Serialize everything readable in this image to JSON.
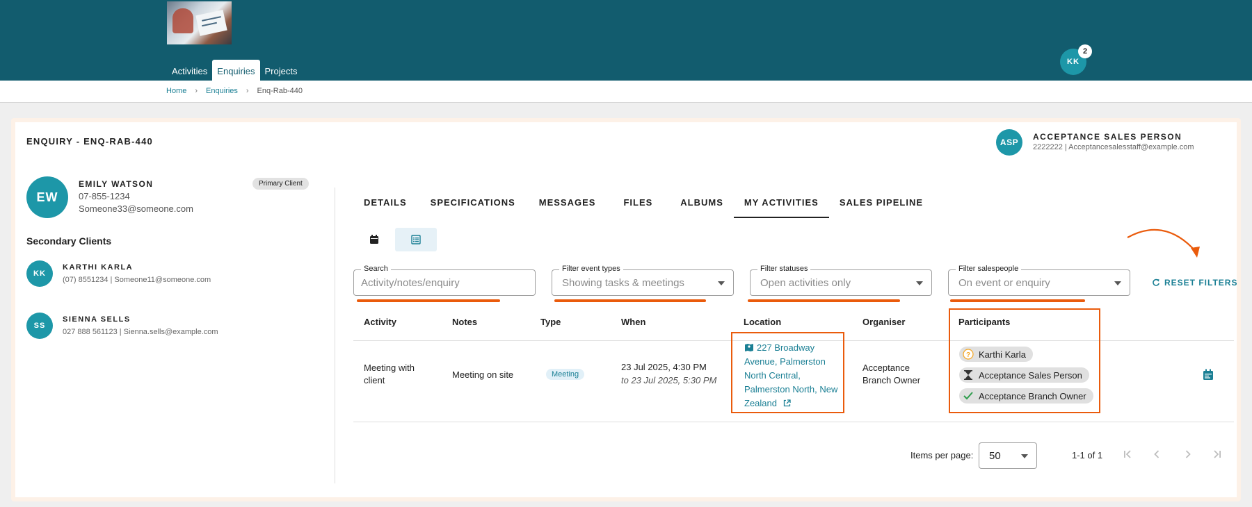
{
  "nav": {
    "items": [
      {
        "label": "Activities"
      },
      {
        "label": "Enquiries",
        "active": true
      },
      {
        "label": "Projects"
      }
    ]
  },
  "user": {
    "initials": "KK",
    "notifications": "2"
  },
  "breadcrumb": {
    "home": "Home",
    "enquiries": "Enquiries",
    "current": "Enq-Rab-440"
  },
  "enquiry": {
    "title": "ENQUIRY - ENQ-RAB-440"
  },
  "salesperson": {
    "initials": "ASP",
    "name": "ACCEPTANCE SALES PERSON",
    "info": "2222222  |  Acceptancesalesstaff@example.com"
  },
  "primary_client": {
    "initials": "EW",
    "name": "EMILY WATSON",
    "phone": "07-855-1234",
    "email": "Someone33@someone.com",
    "badge": "Primary Client"
  },
  "secondary": {
    "title": "Secondary Clients",
    "clients": [
      {
        "initials": "KK",
        "name": "KARTHI KARLA",
        "info": "(07) 8551234  |  Someone11@someone.com"
      },
      {
        "initials": "SS",
        "name": "SIENNA SELLS",
        "info": "027 888 561123  |  Sienna.sells@example.com"
      }
    ]
  },
  "tabs": [
    {
      "label": "DETAILS"
    },
    {
      "label": "SPECIFICATIONS"
    },
    {
      "label": "MESSAGES"
    },
    {
      "label": "FILES"
    },
    {
      "label": "ALBUMS"
    },
    {
      "label": "MY ACTIVITIES",
      "active": true
    },
    {
      "label": "SALES PIPELINE"
    }
  ],
  "filters": {
    "search": {
      "label": "Search",
      "placeholder": "Activity/notes/enquiry",
      "value": ""
    },
    "event_types": {
      "label": "Filter event types",
      "value": "Showing tasks & meetings"
    },
    "statuses": {
      "label": "Filter statuses",
      "value": "Open activities only"
    },
    "salespeople": {
      "label": "Filter salespeople",
      "value": "On event or enquiry"
    },
    "reset_label": "RESET FILTERS"
  },
  "table": {
    "headers": [
      "Activity",
      "Notes",
      "Type",
      "When",
      "Location",
      "Organiser",
      "Participants"
    ],
    "rows": [
      {
        "activity": "Meeting with client",
        "notes": "Meeting on site",
        "type": "Meeting",
        "when_start": "23 Jul 2025, 4:30 PM",
        "when_end": "to 23 Jul 2025, 5:30 PM",
        "location": "227 Broadway Avenue, Palmerston North Central, Palmerston North, New Zealand",
        "organiser": "Acceptance Branch Owner",
        "participants": [
          {
            "name": "Karthi Karla",
            "status_icon": "question-icon"
          },
          {
            "name": "Acceptance Sales Person",
            "status_icon": "hourglass-icon"
          },
          {
            "name": "Acceptance Branch Owner",
            "status_icon": "check-icon"
          }
        ]
      }
    ]
  },
  "pagination": {
    "items_per_page_label": "Items per page:",
    "items_per_page": "50",
    "range": "1-1 of 1"
  },
  "colors": {
    "brand": "#125c6e",
    "accent": "#1d97a8",
    "link": "#1a7f94",
    "highlight": "#ea5b0c"
  }
}
